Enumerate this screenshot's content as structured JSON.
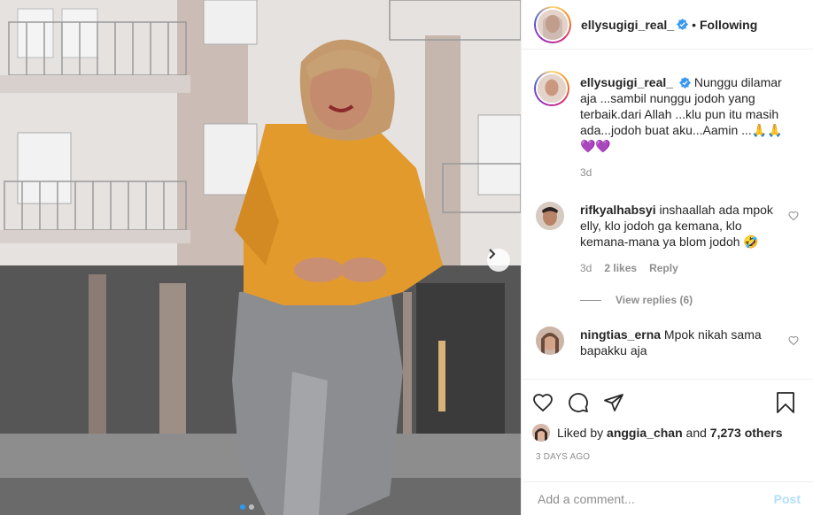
{
  "post": {
    "author": "ellysugigi_real_",
    "follow_status": "Following",
    "bullet": "•",
    "caption": "Nunggu dilamar aja ...sambil nunggu jodoh yang terbaik.dari Allah ...klu pun itu masih ada...jodoh buat aku...Aamin ...🙏🙏💜💜",
    "caption_time": "3d"
  },
  "comments": [
    {
      "user": "rifkyalhabsyi",
      "text": "inshaallah ada mpok elly, klo jodoh ga kemana, klo kemana-mana ya blom jodoh 🤣",
      "time": "3d",
      "likes": "2 likes",
      "reply": "Reply",
      "view_replies": "View replies (6)"
    },
    {
      "user": "ningtias_erna",
      "text": "Mpok nikah sama bapakku aja"
    }
  ],
  "likes": {
    "prefix": "Liked by",
    "user": "anggia_chan",
    "and": "and",
    "others": "7,273 others"
  },
  "time_ago": "3 DAYS AGO",
  "add_comment": {
    "placeholder": "Add a comment...",
    "post_label": "Post"
  },
  "carousel": {
    "count": 2,
    "active": 0
  },
  "colors": {
    "verified": "#3897f0",
    "post_button_disabled": "#b2dffc",
    "muted_text": "#8e8e8e",
    "active_dot": "#2b9af3"
  },
  "icons": [
    "verified-icon",
    "heart-icon",
    "comment-icon",
    "share-icon",
    "bookmark-icon",
    "chevron-right-icon"
  ]
}
